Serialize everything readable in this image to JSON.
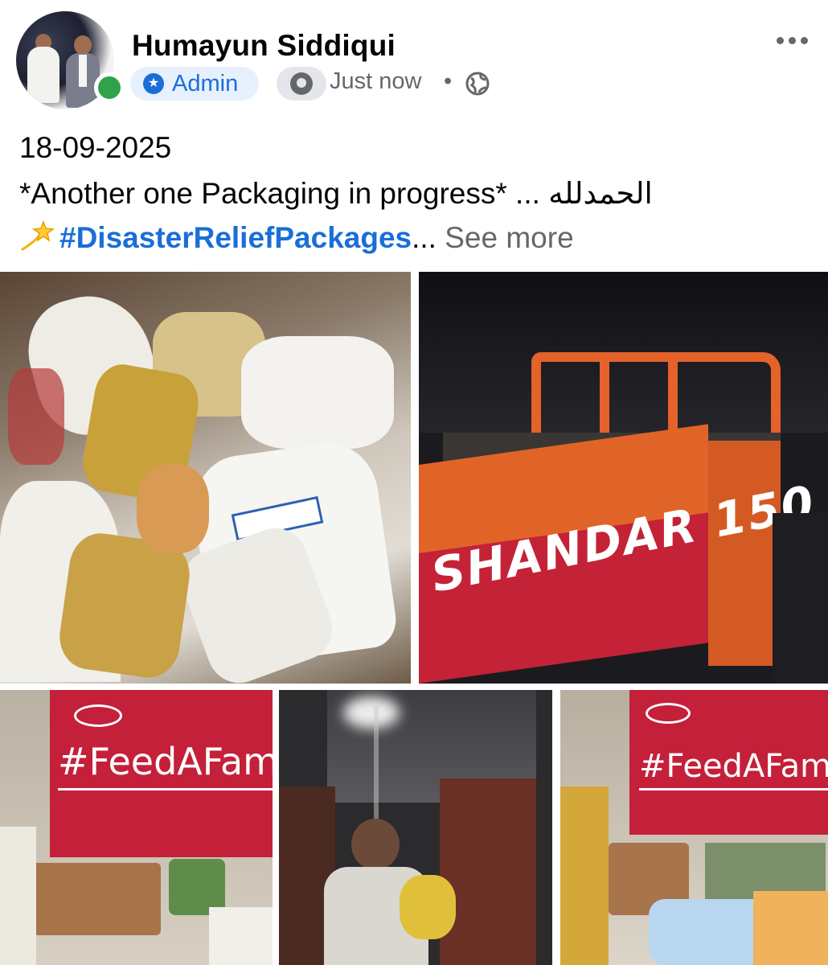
{
  "post": {
    "author_name": "Humayun Siddiqui",
    "role_badge": "Admin",
    "timestamp": "Just now",
    "separator": "•",
    "date_line": "18-09-2025",
    "text_line": "*Another one Packaging in progress* ... الحمدلله",
    "hashtag": "#DisasterReliefPackages",
    "ellipsis": "...",
    "see_more": "See more"
  },
  "photos": {
    "truck_label": "SHANDAR 150",
    "banner_left": "#FeedAFam",
    "banner_right": "#FeedAFamily"
  },
  "icons": {
    "admin": "shield-star-icon",
    "award": "award-badge-icon",
    "privacy": "globe-icon",
    "more": "more-options-icon",
    "emoji": "dizzy-sparkle-icon"
  },
  "colors": {
    "link_blue": "#1a6ed8",
    "secondary_text": "#65676b",
    "online_green": "#31a24c",
    "banner_red": "#c4203a"
  }
}
